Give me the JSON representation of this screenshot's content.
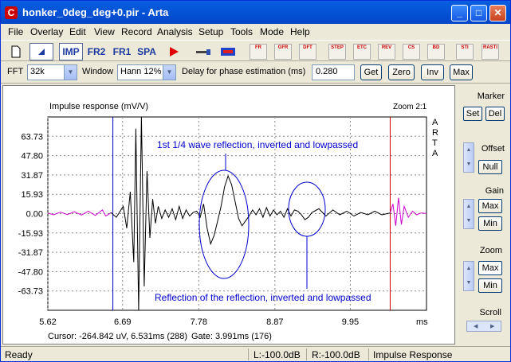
{
  "window": {
    "title": "honker_0deg_deg+0.pir - Arta",
    "app_letter": "C",
    "min": "_",
    "max": "□",
    "close": "✕"
  },
  "menu": [
    "File",
    "Overlay",
    "Edit",
    "View",
    "Record",
    "Analysis",
    "Setup",
    "Tools",
    "Mode",
    "Help"
  ],
  "toolbar": {
    "imp": "IMP",
    "fr2": "FR2",
    "fr1": "FR1",
    "spa": "SPA",
    "graph_buttons": [
      "FR",
      "GFR",
      "DFT",
      "STEP",
      "ETC",
      "REV",
      "CS",
      "BD",
      "STI",
      "RASTI"
    ]
  },
  "settings": {
    "fft_label": "FFT",
    "fft_value": "32k",
    "window_label": "Window",
    "window_value": "Hann 12%",
    "delay_label": "Delay for phase estimation (ms)",
    "delay_value": "0.280",
    "get_btn": "Get",
    "zero_btn": "Zero",
    "inv_btn": "Inv",
    "max_btn": "Max"
  },
  "plot": {
    "title": "Impulse response (mV/V)",
    "zoom": "Zoom 2:1",
    "watermark": [
      "A",
      "R",
      "T",
      "A"
    ],
    "y_ticks": [
      "63.73",
      "47.80",
      "31.87",
      "15.93",
      "0.00",
      "-15.93",
      "-31.87",
      "-47.80",
      "-63.73"
    ],
    "x_ticks": [
      "5.62",
      "6.69",
      "7.78",
      "8.87",
      "9.95"
    ],
    "x_unit": "ms",
    "annotation1": "1st 1/4 wave reflection, inverted and lowpassed",
    "annotation2": "Reflection of the reflection, inverted and lowpassed",
    "cursor": "Cursor: -264.842 uV, 6.531ms (288)",
    "gate": "Gate: 3.991ms (176)"
  },
  "chart_data": {
    "type": "line",
    "title": "Impulse response (mV/V)",
    "xlabel": "ms",
    "ylabel": "",
    "xlim": [
      5.62,
      11.04
    ],
    "ylim": [
      -79.66,
      79.66
    ],
    "y_ticks": [
      63.73,
      47.8,
      31.87,
      15.93,
      0.0,
      -15.93,
      -31.87,
      -47.8,
      -63.73
    ],
    "x_ticks": [
      5.62,
      6.69,
      7.78,
      8.87,
      9.95
    ],
    "markers": {
      "cursor_ms": 6.531,
      "gate_end_ms": 10.52
    },
    "series": [
      {
        "color": "#cc00cc",
        "x": [
          5.62,
          5.7,
          5.8,
          5.9,
          6.0,
          6.1,
          6.2,
          6.3,
          6.4,
          6.45,
          6.52
        ],
        "y": [
          0.5,
          -1.0,
          1.2,
          -0.8,
          1.5,
          -1.2,
          2.0,
          -1.5,
          3.0,
          -2.0,
          0.5
        ]
      },
      {
        "color": "#000000",
        "x": [
          6.52,
          6.6,
          6.7,
          6.75,
          6.8,
          6.85,
          6.88,
          6.92,
          6.96,
          7.0,
          7.04,
          7.08,
          7.12,
          7.16,
          7.2,
          7.25,
          7.3,
          7.35,
          7.4,
          7.45,
          7.5,
          7.55,
          7.6,
          7.65,
          7.7,
          7.75,
          7.8,
          7.85,
          7.9,
          7.95,
          8.0,
          8.05,
          8.1,
          8.15,
          8.2,
          8.25,
          8.3,
          8.35,
          8.4,
          8.45,
          8.5,
          8.55,
          8.6,
          8.65,
          8.7,
          8.75,
          8.8,
          8.85,
          8.9,
          8.95,
          9.0,
          9.05,
          9.1,
          9.15,
          9.2,
          9.25,
          9.3,
          9.35,
          9.4,
          9.5,
          9.6,
          9.7,
          9.8,
          9.9,
          10.0,
          10.1,
          10.2,
          10.3,
          10.4,
          10.52
        ],
        "y": [
          1.0,
          -3.0,
          6.0,
          -12.0,
          18.0,
          -40.0,
          70.0,
          -80.0,
          80.0,
          -60.0,
          35.0,
          -20.0,
          12.0,
          -8.0,
          6.0,
          -4.0,
          3.0,
          -3.0,
          4.0,
          -5.0,
          6.0,
          -4.0,
          3.0,
          -2.0,
          1.0,
          2.0,
          -3.0,
          8.0,
          -12.0,
          -25.0,
          -18.0,
          -6.0,
          6.0,
          22.0,
          31.0,
          24.0,
          10.0,
          -4.0,
          -10.0,
          -6.0,
          -2.0,
          3.0,
          -1.0,
          4.0,
          -3.0,
          5.0,
          -2.0,
          3.0,
          -1.0,
          2.0,
          -3.0,
          4.0,
          -2.0,
          3.0,
          2.0,
          -1.0,
          -5.0,
          -3.0,
          1.0,
          4.0,
          -2.0,
          3.0,
          -1.0,
          2.0,
          -2.0,
          1.0,
          -1.0,
          2.0,
          -1.0,
          0.5
        ]
      },
      {
        "color": "#cc00cc",
        "x": [
          10.52,
          10.56,
          10.6,
          10.64,
          10.68,
          10.72,
          10.78,
          10.84,
          10.9,
          10.96,
          11.04
        ],
        "y": [
          0.5,
          8.0,
          -10.0,
          13.0,
          -9.0,
          6.0,
          -3.0,
          2.0,
          -1.0,
          0.5,
          0.2
        ]
      }
    ]
  },
  "right_panel": {
    "marker_label": "Marker",
    "set_btn": "Set",
    "del_btn": "Del",
    "offset_label": "Offset",
    "null_btn": "Null",
    "gain_label": "Gain",
    "gain_max": "Max",
    "gain_min": "Min",
    "zoom_label": "Zoom",
    "zoom_max": "Max",
    "zoom_min": "Min",
    "scroll_label": "Scroll"
  },
  "status": {
    "ready": "Ready",
    "left": "L:-100.0dB",
    "right": "R:-100.0dB",
    "mode": "Impulse Response"
  },
  "colors": {
    "titlebar": "#0455d8",
    "plot_line": "#000000",
    "gated_line": "#cc00cc",
    "gate_marker": "#0000cc",
    "gate_end": "#cc0000",
    "annotation": "#0000cc"
  }
}
